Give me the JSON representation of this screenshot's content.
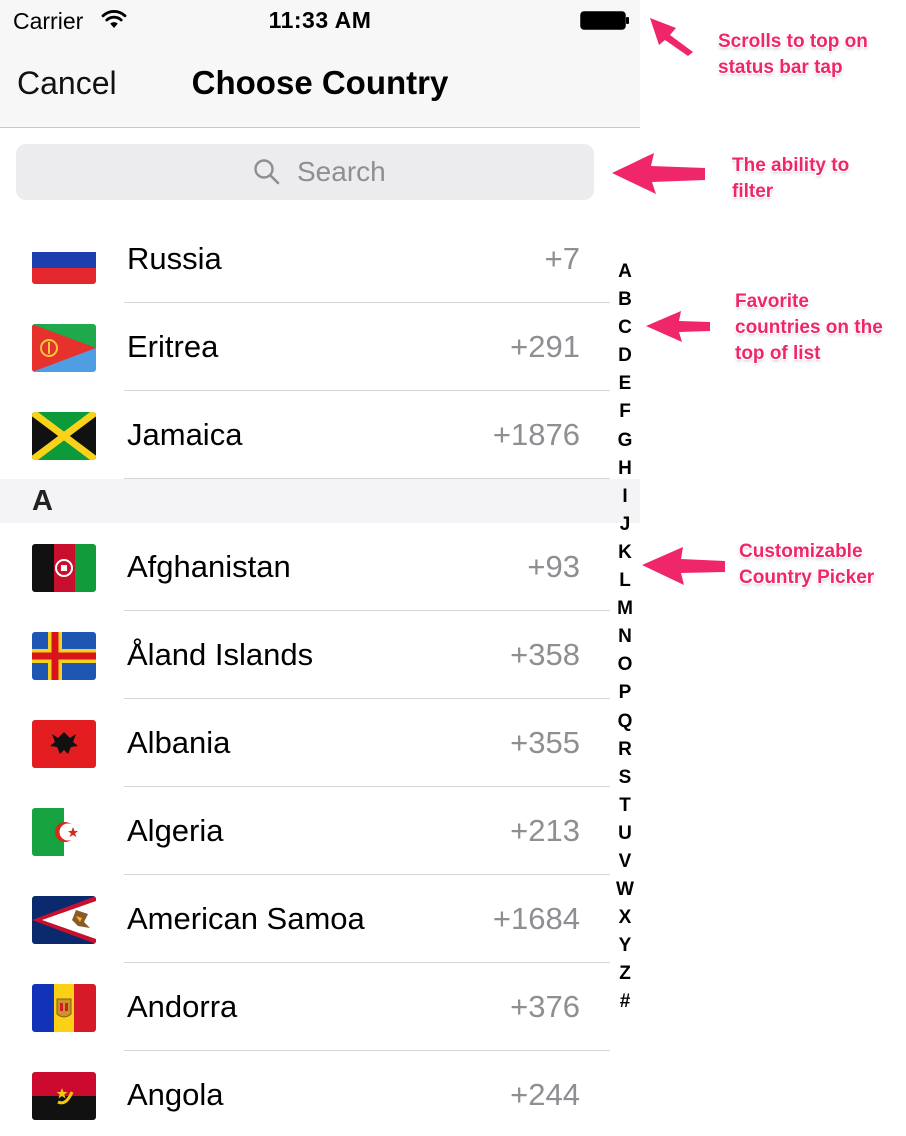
{
  "status_bar": {
    "carrier": "Carrier",
    "time": "11:33 AM"
  },
  "nav": {
    "cancel_label": "Cancel",
    "title": "Choose Country"
  },
  "search": {
    "placeholder": "Search"
  },
  "favorites": [
    {
      "name": "Russia",
      "code": "+7",
      "flag": "flag-russia"
    },
    {
      "name": "Eritrea",
      "code": "+291",
      "flag": "flag-eritrea"
    },
    {
      "name": "Jamaica",
      "code": "+1876",
      "flag": "flag-jamaica"
    }
  ],
  "section": {
    "header": "A",
    "countries": [
      {
        "name": "Afghanistan",
        "code": "+93",
        "flag": "flag-afghanistan"
      },
      {
        "name": "Åland Islands",
        "code": "+358",
        "flag": "flag-aland"
      },
      {
        "name": "Albania",
        "code": "+355",
        "flag": "flag-albania"
      },
      {
        "name": "Algeria",
        "code": "+213",
        "flag": "flag-algeria"
      },
      {
        "name": "American Samoa",
        "code": "+1684",
        "flag": "flag-american-samoa"
      },
      {
        "name": "Andorra",
        "code": "+376",
        "flag": "flag-andorra"
      },
      {
        "name": "Angola",
        "code": "+244",
        "flag": "flag-angola"
      }
    ]
  },
  "index_letters": [
    "A",
    "B",
    "C",
    "D",
    "E",
    "F",
    "G",
    "H",
    "I",
    "J",
    "K",
    "L",
    "M",
    "N",
    "O",
    "P",
    "Q",
    "R",
    "S",
    "T",
    "U",
    "V",
    "W",
    "X",
    "Y",
    "Z",
    "#"
  ],
  "annotations": {
    "status_bar_tap": "Scrolls to top on status bar tap",
    "filter": "The ability to filter",
    "favorites": "Favorite countries on the top of list",
    "customizable": "Customizable Country Picker"
  },
  "colors": {
    "annotation": "#f0266b",
    "bar_background": "#f7f7f7",
    "secondary_text": "#8e8e93"
  }
}
